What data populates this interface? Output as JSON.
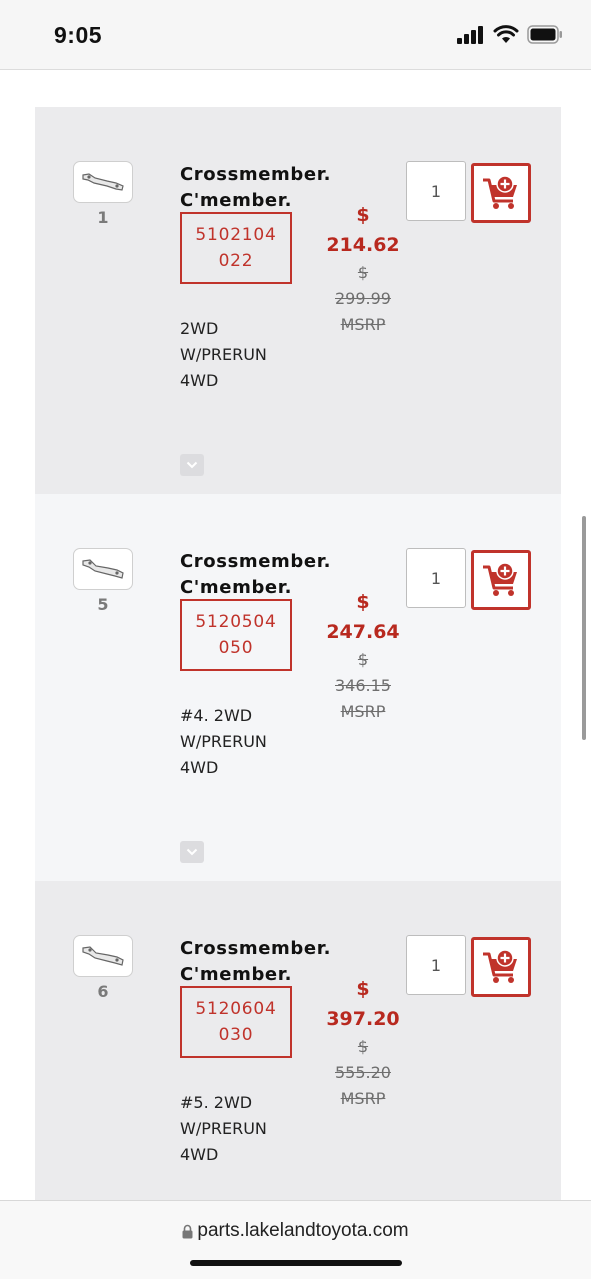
{
  "status_bar": {
    "time": "9:05"
  },
  "products": [
    {
      "ref": "1",
      "name_lines": [
        "Crossmember.",
        "C'member."
      ],
      "part_number": "5102104022",
      "price_symbol": "$",
      "price": "214.62",
      "msrp_symbol": "$",
      "msrp": "299.99",
      "msrp_label": "MSRP",
      "desc_lines": [
        "2WD",
        "W/PRERUNNER",
        "4WD"
      ],
      "quantity": "1"
    },
    {
      "ref": "5",
      "name_lines": [
        "Crossmember.",
        "C'member."
      ],
      "part_number": "5120504050",
      "price_symbol": "$",
      "price": "247.64",
      "msrp_symbol": "$",
      "msrp": "346.15",
      "msrp_label": "MSRP",
      "desc_lines": [
        "#4. 2WD",
        "W/PRERUNNER",
        "4WD"
      ],
      "quantity": "1"
    },
    {
      "ref": "6",
      "name_lines": [
        "Crossmember.",
        "C'member."
      ],
      "part_number": "5120604030",
      "price_symbol": "$",
      "price": "397.20",
      "msrp_symbol": "$",
      "msrp": "555.20",
      "msrp_label": "MSRP",
      "desc_lines": [
        "#5. 2WD",
        "W/PRERUNNER",
        "4WD"
      ],
      "quantity": "1"
    }
  ],
  "browser": {
    "url": "parts.lakelandtoyota.com"
  },
  "icons": {
    "thumb": "crossmember-part-icon",
    "cart": "add-to-cart-icon",
    "expand": "chevron-down-icon",
    "lock": "lock-icon"
  },
  "colors": {
    "accent": "#c0332b",
    "price": "#b8291f"
  }
}
